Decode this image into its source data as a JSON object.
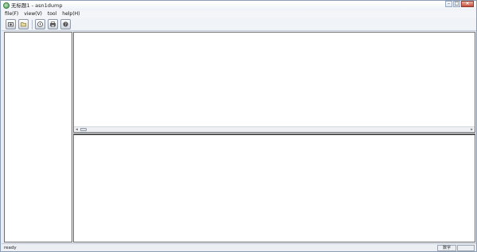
{
  "window": {
    "title": "无标题1 - asn1dump",
    "controls": {
      "minimize": "–",
      "maximize": "□",
      "close": "×"
    }
  },
  "menu": {
    "items": [
      "file(F)",
      "view(V)",
      "tool",
      "help(H)"
    ]
  },
  "toolbar": {
    "buttons": [
      "open-icon",
      "folder-icon",
      "info-icon",
      "print-icon",
      "help-icon"
    ]
  },
  "scrollbar": {
    "left_arrow": "◂",
    "right_arrow": "▸"
  },
  "status": {
    "text": "ready",
    "indicator": "数字"
  }
}
